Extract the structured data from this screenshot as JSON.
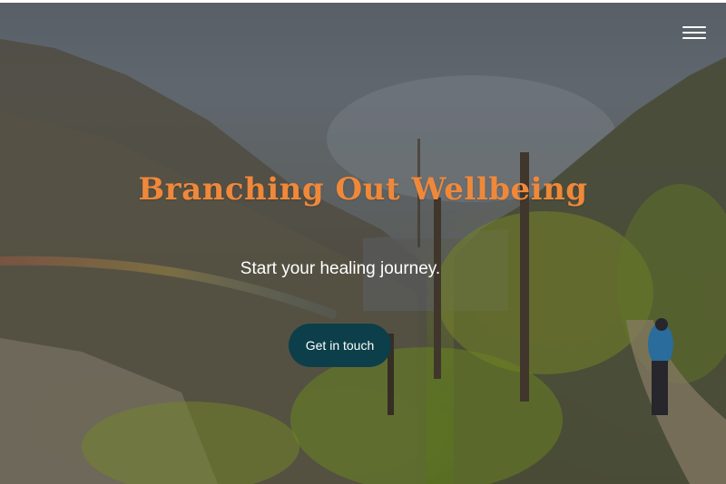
{
  "header": {
    "menu_icon": "hamburger-menu-icon"
  },
  "hero": {
    "title": "Branching Out Wellbeing",
    "subtitle": "Start your healing journey.",
    "cta_label": "Get in touch",
    "background": "mountain-valley-hiking-trail-photo"
  },
  "colors": {
    "title": "#f0883a",
    "cta_background": "#0c3f4a",
    "text": "#ffffff"
  }
}
